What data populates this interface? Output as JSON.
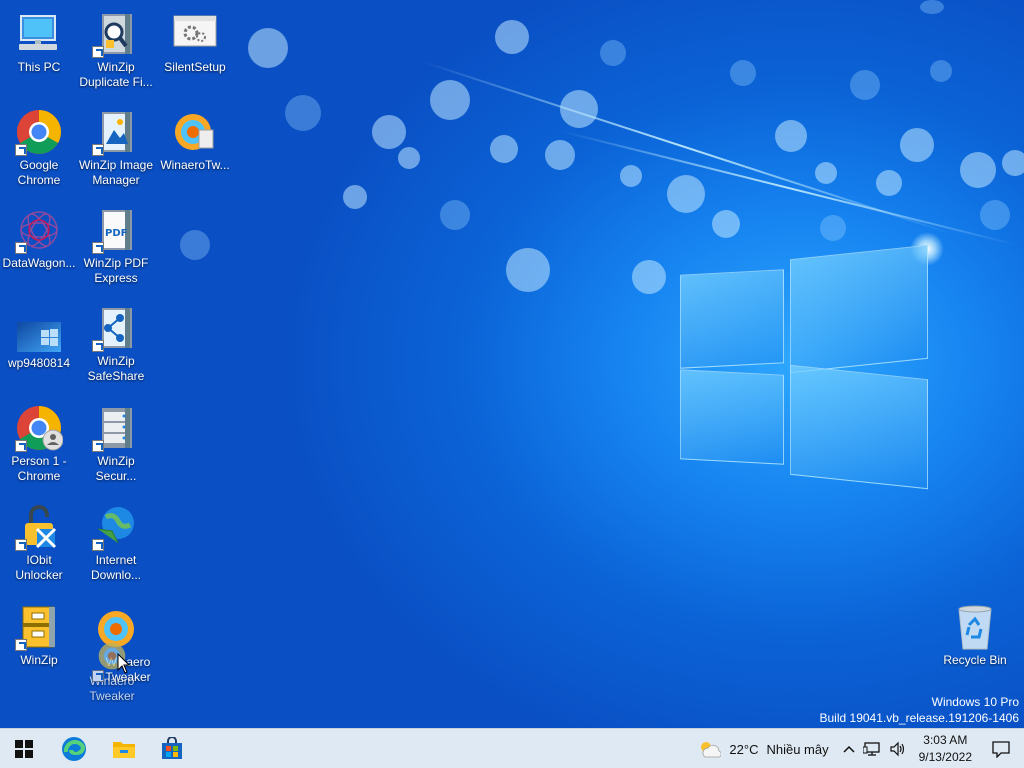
{
  "desktop": {
    "icons": [
      {
        "label": "This PC",
        "icon": "this-pc-icon"
      },
      {
        "label": "WinZip Duplicate Fi...",
        "icon": "winzip-duplicate-finder-icon"
      },
      {
        "label": "SilentSetup",
        "icon": "silentsetup-icon"
      },
      {
        "label": "Google Chrome",
        "icon": "chrome-icon"
      },
      {
        "label": "WinZip Image Manager",
        "icon": "winzip-image-manager-icon"
      },
      {
        "label": "WinaeroTw...",
        "icon": "winaero-tweaker-icon"
      },
      {
        "label": "DataWagon...",
        "icon": "datawagon-icon"
      },
      {
        "label": "WinZip PDF Express",
        "icon": "winzip-pdf-express-icon"
      },
      {
        "label": "wp9480814",
        "icon": "wallpaper-image-icon"
      },
      {
        "label": "WinZip SafeShare",
        "icon": "winzip-safeshare-icon"
      },
      {
        "label": "Person 1 - Chrome",
        "icon": "chrome-person-icon"
      },
      {
        "label": "WinZip Secur...",
        "icon": "winzip-secure-backup-icon"
      },
      {
        "label": "IObit Unlocker",
        "icon": "iobit-unlocker-icon"
      },
      {
        "label": "Internet Downlo...",
        "icon": "internet-download-manager-icon"
      },
      {
        "label": "WinZip",
        "icon": "winzip-icon"
      },
      {
        "label": "Winaero Tweaker",
        "icon": "winaero-tweaker-icon"
      },
      {
        "label": "Winaero Tweaker",
        "icon": "winaero-tweaker-drag-ghost-icon"
      },
      {
        "label": "Recycle Bin",
        "icon": "recycle-bin-icon"
      }
    ]
  },
  "watermark": {
    "line1": "Windows 10 Pro",
    "line2": "Build 19041.vb_release.191206-1406"
  },
  "taskbar": {
    "pinned": [
      "start-icon",
      "edge-icon",
      "file-explorer-icon",
      "microsoft-store-icon"
    ],
    "weather": {
      "temp": "22°C",
      "condition": "Nhiều mây"
    },
    "clock": {
      "time": "3:03 AM",
      "date": "9/13/2022"
    }
  },
  "colors": {
    "taskbar_bg": "#dfe9f3",
    "wallpaper_accent": "#1683f0"
  }
}
